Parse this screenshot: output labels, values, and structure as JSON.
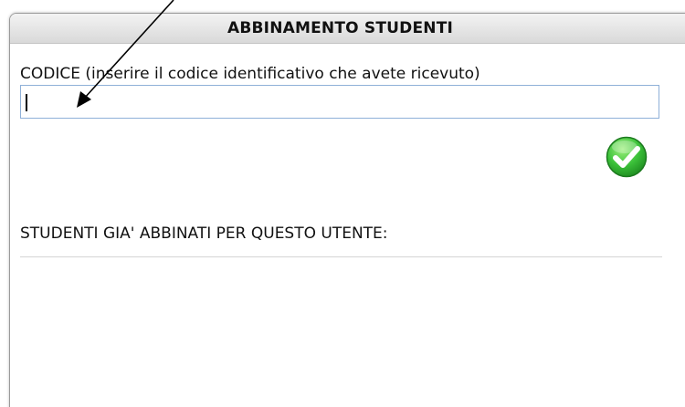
{
  "dialog": {
    "title": "ABBINAMENTO STUDENTI"
  },
  "form": {
    "code_label": "CODICE (inserire il codice identificativo che avete ricevuto)",
    "code_value": "",
    "submit_icon": "green-checkmark-icon"
  },
  "students": {
    "label": "STUDENTI GIA' ABBINATI PER QUESTO UTENTE:",
    "items": []
  },
  "colors": {
    "accent_green": "#2dbb2d",
    "input_border": "#8fb0d8"
  }
}
